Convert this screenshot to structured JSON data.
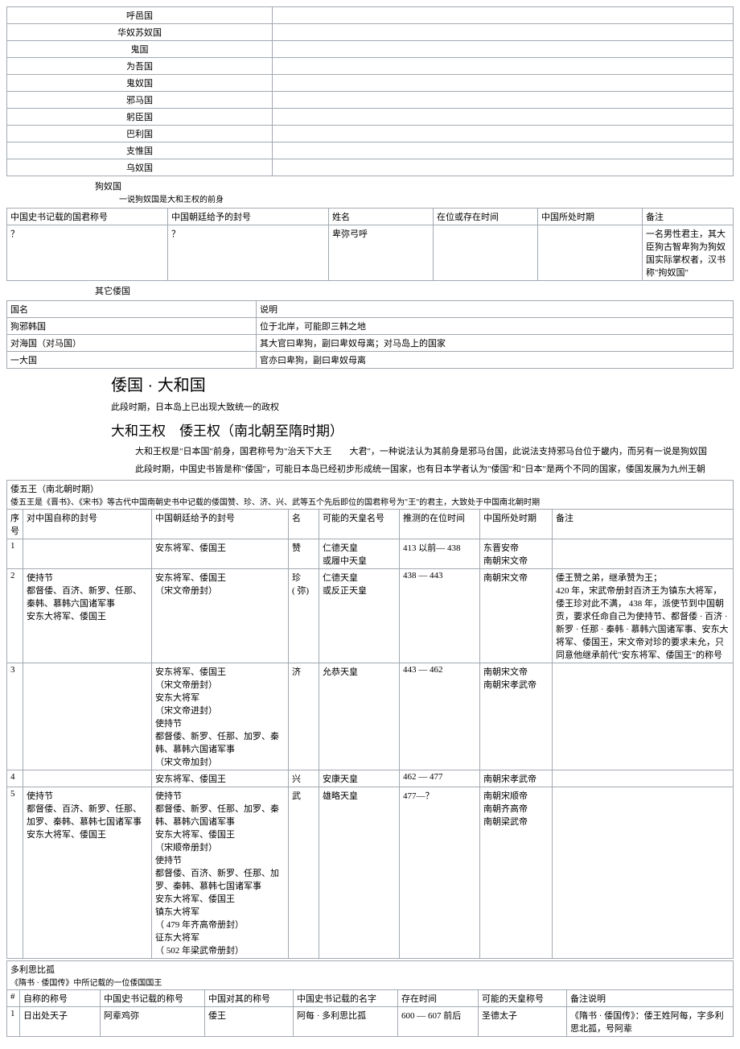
{
  "countries_list": [
    "呼邑国",
    "华奴苏奴国",
    "鬼国",
    "为吾国",
    "鬼奴国",
    "邪马国",
    "躬臣国",
    "巴利国",
    "支惟国",
    "乌奴国"
  ],
  "gounu": {
    "title": "狗奴国",
    "note": "一说狗奴国是大和王权的前身",
    "headers": [
      "中国史书记载的国君称号",
      "中国朝廷给予的封号",
      "姓名",
      "在位或存在时间",
      "中国所处时期",
      "备注"
    ],
    "rows": [
      {
        "c1": "？",
        "c2": "？",
        "c3": "卑弥弓呼",
        "c4": "",
        "c5": "",
        "c6": "一名男性君主，其大臣狗古智卑狗为狗奴国实际掌权者，汉书称\"拘奴国\""
      }
    ]
  },
  "other_wa": {
    "title": "其它倭国",
    "headers": [
      "国名",
      "说明"
    ],
    "rows": [
      {
        "c1": "狗邪韩国",
        "c2": "位于北岸，可能即三韩之地"
      },
      {
        "c1": "对海国（对马国）",
        "c2": "其大官曰卑狗，副曰卑奴母离；对马岛上的国家"
      },
      {
        "c1": "一大国",
        "c2": "官亦曰卑狗，副曰卑奴母离"
      }
    ]
  },
  "section1": {
    "heading": "倭国 · 大和国",
    "desc": "此段时期，日本岛上已出现大致统一的政权"
  },
  "section2": {
    "heading": "大和王权　倭王权（南北朝至隋时期）",
    "desc1": "大和王权是\"日本国\"前身，国君称号为\"治天下大王　　大君\"，一种说法认为其前身是邪马台国，此说法支持邪马台位于畿内，而另有一说是狗奴国",
    "desc2": "此段时期，中国史书皆是称\"倭国\"，可能日本岛已经初步形成统一国家，也有日本学者认为\"倭国\"和\"日本\"是两个不同的国家，倭国发展为九州王朝"
  },
  "five_kings": {
    "caption_title": "倭五王（南北朝时期）",
    "caption_note": "倭五王是《晋书》、《宋书》等古代中国南朝史书中记载的倭国赞、珍、济、兴、武等五个先后即位的国君称号为\"王\"的君主，大致处于中国南北朝时期",
    "headers": [
      "序号",
      "对中国自称的封号",
      "中国朝廷给予的封号",
      "名",
      "可能的天皇名号",
      "推测的在位时间",
      "中国所处时期",
      "备注"
    ],
    "rows": [
      {
        "n": "1",
        "c1": "",
        "c2": "安东将军、倭国王",
        "c3": "赞",
        "c4": "仁德天皇\n或履中天皇",
        "c5": "413 以前— 438",
        "c6": "东晋安帝\n南朝宋文帝",
        "c7": ""
      },
      {
        "n": "2",
        "c1": "使持节\n都督倭、百济、新罗、任那、秦韩、慕韩六国诸军事\n安东大将军、倭国王",
        "c2": "安东将军、倭国王\n（宋文帝册封）",
        "c3": "珍\n( 弥)",
        "c4": "仁德天皇\n或反正天皇",
        "c5": "438 — 443",
        "c6": "南朝宋文帝",
        "c7": "倭王赞之弟，继承赞为王；\n420 年，宋武帝册封百济王为镇东大将军，倭王珍对此不满，  438 年，派使节到中国朝贡，要求任命自己为使持节、都督倭 · 百济 · 新罗 · 任那 · 秦韩 · 慕韩六国诸军事、安东大将军、倭国王，宋文帝对珍的要求未允，只同意他继承前代\"安东将军、倭国王\"的称号"
      },
      {
        "n": "3",
        "c1": "",
        "c2": "安东将军、倭国王\n（宋文帝册封）\n安东大将军\n（宋文帝进封）\n使持节\n都督倭、新罗、任那、加罗、秦韩、慕韩六国诸军事\n（宋文帝加封）",
        "c3": "济",
        "c4": "允恭天皇",
        "c5": "443 — 462",
        "c6": "南朝宋文帝\n南朝宋孝武帝",
        "c7": ""
      },
      {
        "n": "4",
        "c1": "",
        "c2": "安东将军、倭国王",
        "c3": "兴",
        "c4": "安康天皇",
        "c5": "462 — 477",
        "c6": "南朝宋孝武帝",
        "c7": ""
      },
      {
        "n": "5",
        "c1": "使持节\n都督倭、百济、新罗、任那、加罗、秦韩、慕韩七国诸军事\n安东大将军、倭国王",
        "c2": "使持节\n都督倭、新罗、任那、加罗、秦韩、慕韩六国诸军事\n安东大将军、倭国王\n（宋顺帝册封）\n使持节\n都督倭、百济、新罗、任那、加罗、秦韩、慕韩七国诸军事\n安东大将军、倭国王\n镇东大将军\n（ 479 年齐高帝册封）\n征东大将军\n（ 502 年梁武帝册封）",
        "c3": "武",
        "c4": "雄略天皇",
        "c5": "477—？",
        "c6": "南朝宋顺帝\n南朝齐高帝\n南朝梁武帝",
        "c7": ""
      }
    ]
  },
  "duolisi": {
    "caption_title": "多利思比孤",
    "caption_note": "《隋书 · 倭国传》中所记载的一位倭国国王",
    "headers": [
      "#",
      "自称的称号",
      "中国史书记载的称号",
      "中国对其的称号",
      "中国史书记载的名字",
      "存在时间",
      "可能的天皇称号",
      "备注说明"
    ],
    "rows": [
      {
        "n": "1",
        "c1": "日出处天子",
        "c2": "阿辈鸡弥",
        "c3": "倭王",
        "c4": "阿每 · 多利思比孤",
        "c5": "600 — 607 前后",
        "c6": "圣德太子",
        "c7": "《隋书 · 倭国传》：倭王姓阿每，字多利思北孤，号阿辈"
      }
    ]
  }
}
